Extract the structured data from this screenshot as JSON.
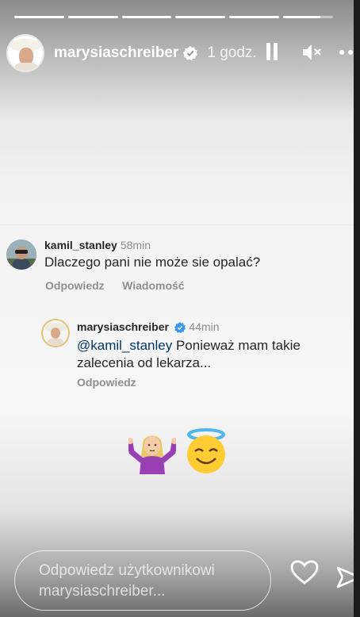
{
  "progress": [
    1,
    1,
    1,
    1,
    1,
    0.75
  ],
  "header": {
    "username": "marysiaschreiber",
    "time": "1 godz.",
    "icons": [
      "avatar",
      "verified-badge-icon",
      "pause-icon",
      "mute-icon",
      "more-icon"
    ]
  },
  "comment": {
    "username": "kamil_stanley",
    "time": "58min",
    "text": "Dlaczego pani nie może sie opalać?",
    "reply_label": "Odpowiedz",
    "message_label": "Wiadomość"
  },
  "reply": {
    "username": "marysiaschreiber",
    "time": "44min",
    "mention": "@kamil_stanley",
    "text_line1": " Ponieważ mam takie",
    "text_line2": "zalecenia od lekarza...",
    "reply_label": "Odpowiedz"
  },
  "stickers": [
    "woman-shrugging",
    "smiling-face-with-halo"
  ],
  "footer": {
    "placeholder_line1": "Odpowiedz użytkownikowi",
    "placeholder_line2": "marysiaschreiber...",
    "icons": [
      "heart-icon",
      "send-icon"
    ]
  },
  "colors": {
    "verified": "#3897f0",
    "mention": "#00376b",
    "muted_text": "#8e8e8e"
  }
}
